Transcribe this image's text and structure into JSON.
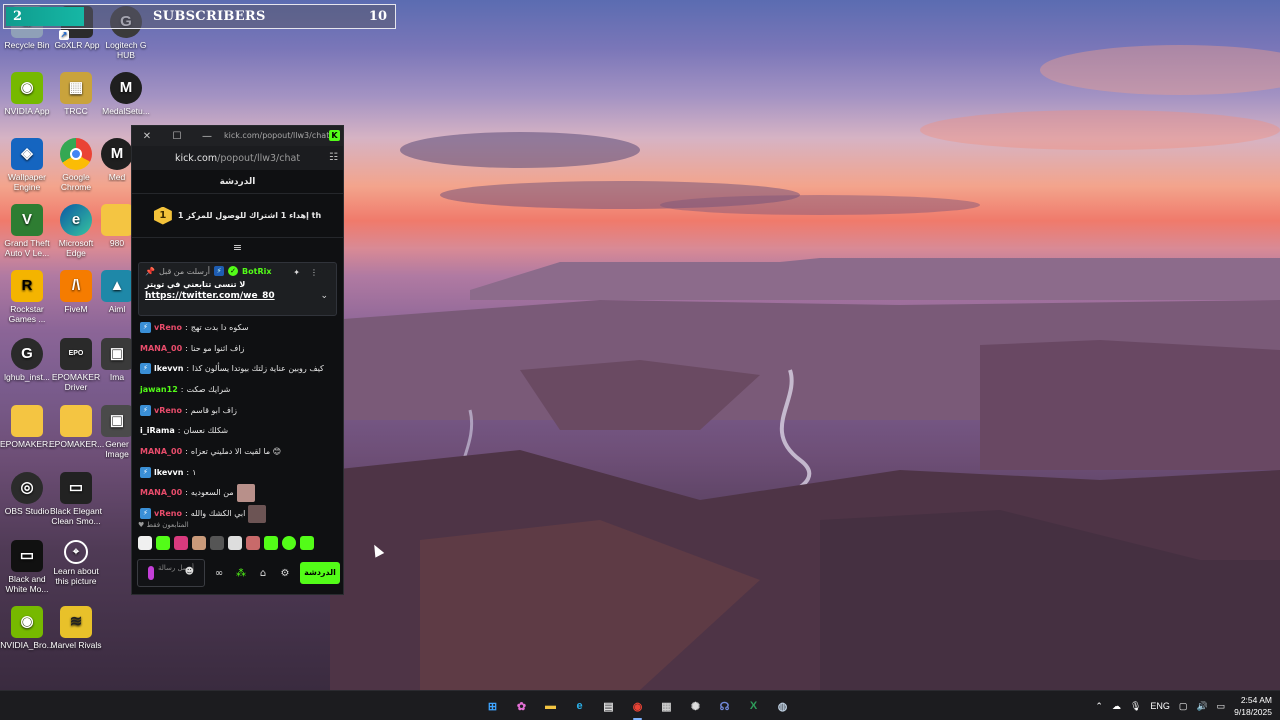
{
  "overlay": {
    "subscriber_count": "2",
    "label": "SUBSCRIBERS",
    "goal": "10",
    "progress_fraction": 0.2
  },
  "desktop_icons": [
    {
      "name": "recycle-bin",
      "label": "Recycle Bin",
      "color": "#8fa0b8",
      "glyph": ""
    },
    {
      "name": "goxlr-app",
      "label": "GoXLR App",
      "color": "#2b2b2b",
      "glyph": ""
    },
    {
      "name": "logitech-g-hub",
      "label": "Logitech G HUB",
      "color": "#3a3a3a",
      "glyph": "G"
    },
    {
      "name": "nvidia-app",
      "label": "NVIDIA App",
      "color": "#76b900",
      "glyph": ""
    },
    {
      "name": "trcc",
      "label": "TRCC",
      "color": "#c9a33c",
      "glyph": ""
    },
    {
      "name": "medal-setup",
      "label": "MedalSetu...",
      "color": "#1f1f1f",
      "glyph": "M"
    },
    {
      "name": "wallpaper-engine",
      "label": "Wallpaper Engine",
      "color": "#1565c0",
      "glyph": ""
    },
    {
      "name": "google-chrome",
      "label": "Google Chrome",
      "color": "#e53935",
      "glyph": ""
    },
    {
      "name": "medal",
      "label": "Med",
      "color": "#1f1f1f",
      "glyph": "M"
    },
    {
      "name": "gta-v",
      "label": "Grand Theft Auto V Le...",
      "color": "#2e7d32",
      "glyph": "V"
    },
    {
      "name": "microsoft-edge",
      "label": "Microsoft Edge",
      "color": "#0a84c6",
      "glyph": ""
    },
    {
      "name": "folder-980",
      "label": "980",
      "color": "#f4c542",
      "glyph": ""
    },
    {
      "name": "rockstar-games",
      "label": "Rockstar Games ...",
      "color": "#f4b400",
      "glyph": "R"
    },
    {
      "name": "fivem",
      "label": "FiveM",
      "color": "#f57c00",
      "glyph": ""
    },
    {
      "name": "aimlabs",
      "label": "Aiml",
      "color": "#1e88a8",
      "glyph": ""
    },
    {
      "name": "lghub-installer",
      "label": "lghub_inst...",
      "color": "#2a2a2a",
      "glyph": "G"
    },
    {
      "name": "epomaker-driver",
      "label": "EPOMAKER Driver",
      "color": "#2a2a2a",
      "glyph": ""
    },
    {
      "name": "image",
      "label": "Ima",
      "color": "#3a3a3a",
      "glyph": ""
    },
    {
      "name": "epomaker-folder-1",
      "label": "EPOMAKER...",
      "color": "#f4c542",
      "glyph": ""
    },
    {
      "name": "epomaker-folder-2",
      "label": "EPOMAKER...",
      "color": "#f4c542",
      "glyph": ""
    },
    {
      "name": "general-image",
      "label": "Gener Image",
      "color": "#4a4a4a",
      "glyph": ""
    },
    {
      "name": "obs-studio",
      "label": "OBS Studio",
      "color": "#2b2b2b",
      "glyph": ""
    },
    {
      "name": "black-elegant-clean-smoke",
      "label": "Black Elegant Clean Smo...",
      "color": "#222222",
      "glyph": ""
    },
    {
      "name": "black-and-white-mo",
      "label": "Black and White Mo...",
      "color": "#111111",
      "glyph": ""
    },
    {
      "name": "learn-about-picture",
      "label": "Learn about this picture",
      "color": "#5a5a5a",
      "glyph": ""
    },
    {
      "name": "nvidia-broadcast",
      "label": "NVIDIA_Bro...",
      "color": "#76b900",
      "glyph": ""
    },
    {
      "name": "marvel-rivals",
      "label": "Marvel Rivals",
      "color": "#e8c12a",
      "glyph": ""
    }
  ],
  "chat_window": {
    "title": "kick.com/popout/llw3/chat...",
    "url_host": "kick.com",
    "url_path": "/popout/llw3/chat",
    "header": "الدردشة",
    "goal_rank": "1",
    "goal_text": "إهداء 1 اشتراك للوصول للمركز 1 th",
    "pinned": {
      "by_label": "أرسلت من قبل",
      "bot_name": "BotRix",
      "message": "لا تنسى تتابعني في تويتر",
      "link": "https://twitter.com/we_80"
    },
    "messages": [
      {
        "user": "vReno",
        "color": "#e84c6b",
        "badge": true,
        "text": "سكوه دا بدت تهج"
      },
      {
        "user": "MANA_00",
        "color": "#e84c6b",
        "badge": false,
        "text": "زاف اثنوا مو حنا"
      },
      {
        "user": "lkevvn",
        "color": "#ffffff",
        "badge": true,
        "text": "كيف روبين عناية زلتك بيوتدا يسألون كذا"
      },
      {
        "user": "jawan12",
        "color": "#53fc18",
        "badge": false,
        "text": "شرايك صكت"
      },
      {
        "user": "vReno",
        "color": "#e84c6b",
        "badge": true,
        "text": "زاف ابو قاسم"
      },
      {
        "user": "i_iRama",
        "color": "#ffffff",
        "badge": false,
        "text": "شكلك نعسان"
      },
      {
        "user": "MANA_00",
        "color": "#e84c6b",
        "badge": false,
        "text": "ما لقيت الا دمليني تعزاه 😊"
      },
      {
        "user": "lkevvn",
        "color": "#ffffff",
        "badge": true,
        "text": "١"
      },
      {
        "user": "MANA_00",
        "color": "#e84c6b",
        "badge": false,
        "text": "من السعوديه"
      },
      {
        "user": "vReno",
        "color": "#e84c6b",
        "badge": true,
        "text": "ابي الكشك والله"
      }
    ],
    "sub_only_label": "المتابعون فقط",
    "input_placeholder": "أرسل رسالة",
    "send_label": "الدردشة"
  },
  "taskbar": {
    "language": "ENG",
    "time": "2:54 AM",
    "date": "9/18/2025"
  },
  "colors": {
    "kick_green": "#53fc18",
    "accent_teal": "#16b7a5"
  }
}
